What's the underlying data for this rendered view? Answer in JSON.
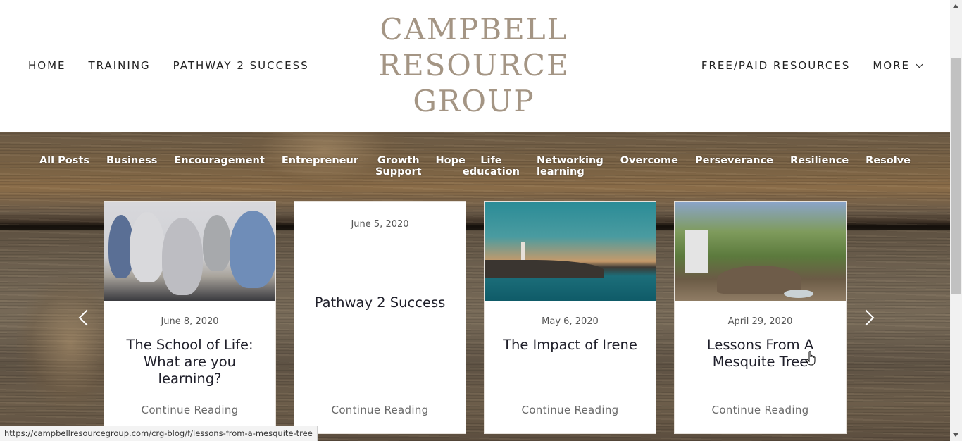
{
  "header": {
    "logo_lines": [
      "CAMPBELL",
      "RESOURCE",
      "GROUP"
    ],
    "nav_left": [
      {
        "label": "HOME"
      },
      {
        "label": "TRAINING"
      },
      {
        "label": "PATHWAY 2 SUCCESS"
      }
    ],
    "nav_right": [
      {
        "label": "FREE/PAID RESOURCES"
      },
      {
        "label": "MORE"
      }
    ],
    "logo_color": "#a49584"
  },
  "blog": {
    "categories": [
      {
        "line1": "All Posts",
        "line2": ""
      },
      {
        "line1": "Business",
        "line2": ""
      },
      {
        "line1": "Encouragement",
        "line2": ""
      },
      {
        "line1": "Entrepreneur",
        "line2": ""
      },
      {
        "line1": "Growth",
        "line2": "Support"
      },
      {
        "line1": "Hope",
        "line2": ""
      },
      {
        "line1": "Life",
        "line2": "education"
      },
      {
        "line1": "Networking",
        "line2": "learning"
      },
      {
        "line1": "Overcome",
        "line2": ""
      },
      {
        "line1": "Perseverance",
        "line2": ""
      },
      {
        "line1": "Resilience",
        "line2": ""
      },
      {
        "line1": "Resolve",
        "line2": ""
      }
    ],
    "posts": [
      {
        "date": "June 8, 2020",
        "title": "The School of Life: What are you learning?",
        "cta": "Continue Reading",
        "image": "students-classroom"
      },
      {
        "date": "June 5, 2020",
        "title": "Pathway 2 Success",
        "cta": "Continue Reading",
        "image": ""
      },
      {
        "date": "May 6, 2020",
        "title": "The Impact of Irene",
        "cta": "Continue Reading",
        "image": "lighthouse-sunset"
      },
      {
        "date": "April 29, 2020",
        "title": "Lessons From A Mesquite Tree",
        "cta": "Continue Reading",
        "image": "mesquite-tree"
      }
    ],
    "prev_icon": "chevron-left-icon",
    "next_icon": "chevron-right-icon"
  },
  "browser": {
    "status_url": "https://campbellresourcegroup.com/crg-blog/f/lessons-from-a-mesquite-tree"
  }
}
